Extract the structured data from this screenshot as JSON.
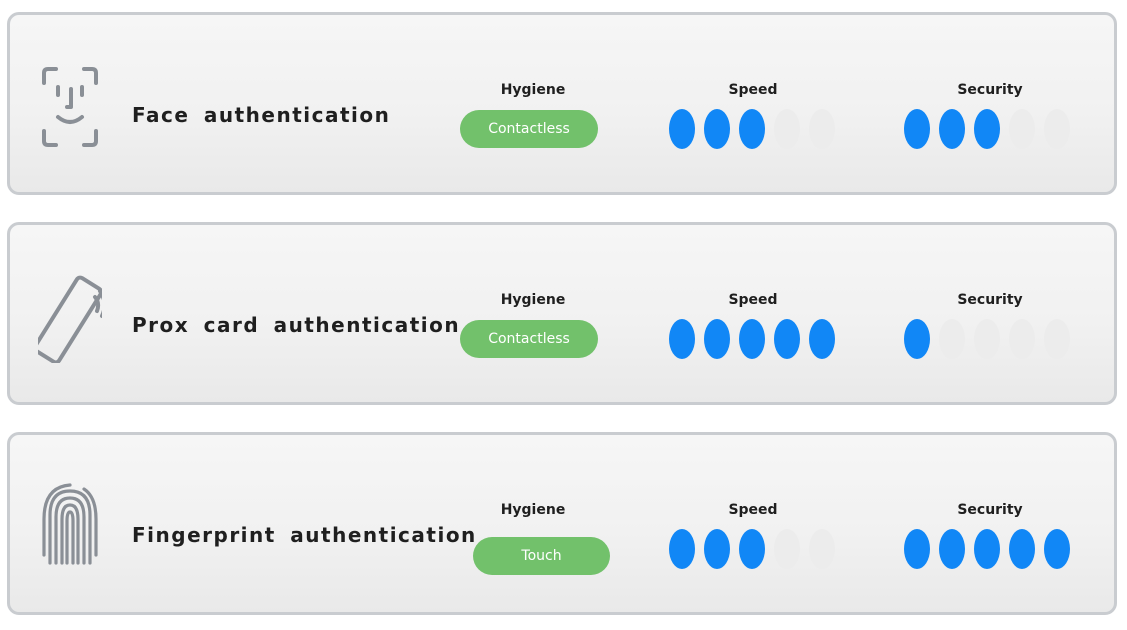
{
  "labels": {
    "hygiene": "Hygiene",
    "speed": "Speed",
    "security": "Security"
  },
  "colors": {
    "rating_on": "#1187f6",
    "rating_off": "#ececec",
    "pill": "#72c16b",
    "icon": "#8a8f96"
  },
  "rating_max": 5,
  "methods": [
    {
      "title": "Face authentication",
      "icon": "face-scan-icon",
      "hygiene": "Contactless",
      "speed": 3,
      "security": 3
    },
    {
      "title": "Prox card authentication",
      "icon": "prox-card-icon",
      "hygiene": "Contactless",
      "speed": 5,
      "security": 1
    },
    {
      "title": "Fingerprint authentication",
      "icon": "fingerprint-icon",
      "hygiene": "Touch",
      "speed": 3,
      "security": 5
    }
  ]
}
